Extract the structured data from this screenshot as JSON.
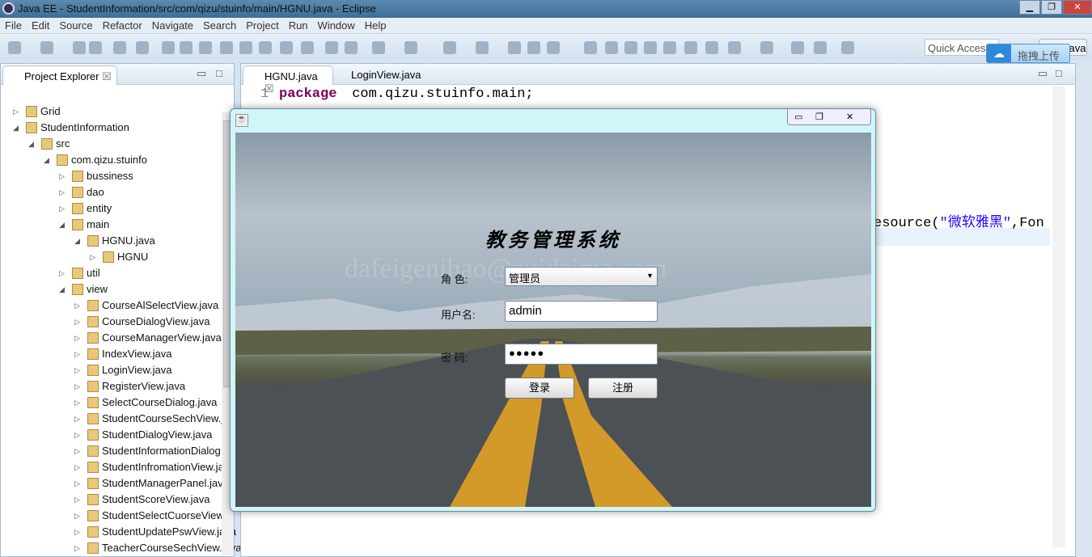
{
  "window": {
    "title": "Java EE - StudentInformation/src/com/qizu/stuinfo/main/HGNU.java - Eclipse",
    "minimize": "▁",
    "restore": "❐",
    "close": "✕"
  },
  "menu": [
    "File",
    "Edit",
    "Source",
    "Refactor",
    "Navigate",
    "Search",
    "Project",
    "Run",
    "Window",
    "Help"
  ],
  "quick_access": "Quick Access",
  "perspective": "Java EE",
  "upload": {
    "label": "拖拽上传"
  },
  "project_explorer": {
    "title": "Project Explorer",
    "items": [
      {
        "label": "Grid",
        "depth": 0,
        "open": false
      },
      {
        "label": "StudentInformation",
        "depth": 0,
        "open": true
      },
      {
        "label": "src",
        "depth": 1,
        "open": true
      },
      {
        "label": "com.qizu.stuinfo",
        "depth": 2,
        "open": true
      },
      {
        "label": "bussiness",
        "depth": 3,
        "open": false
      },
      {
        "label": "dao",
        "depth": 3,
        "open": false
      },
      {
        "label": "entity",
        "depth": 3,
        "open": false
      },
      {
        "label": "main",
        "depth": 3,
        "open": true
      },
      {
        "label": "HGNU.java",
        "depth": 4,
        "open": true
      },
      {
        "label": "HGNU",
        "depth": 5,
        "open": false
      },
      {
        "label": "util",
        "depth": 3,
        "open": false
      },
      {
        "label": "view",
        "depth": 3,
        "open": true
      },
      {
        "label": "CourseAlSelectView.java",
        "depth": 4,
        "open": false
      },
      {
        "label": "CourseDialogView.java",
        "depth": 4,
        "open": false
      },
      {
        "label": "CourseManagerView.java",
        "depth": 4,
        "open": false
      },
      {
        "label": "IndexView.java",
        "depth": 4,
        "open": false
      },
      {
        "label": "LoginView.java",
        "depth": 4,
        "open": false
      },
      {
        "label": "RegisterView.java",
        "depth": 4,
        "open": false
      },
      {
        "label": "SelectCourseDialog.java",
        "depth": 4,
        "open": false
      },
      {
        "label": "StudentCourseSechView.java",
        "depth": 4,
        "open": false
      },
      {
        "label": "StudentDialogView.java",
        "depth": 4,
        "open": false
      },
      {
        "label": "StudentInformationDialog",
        "depth": 4,
        "open": false
      },
      {
        "label": "StudentInfromationView.java",
        "depth": 4,
        "open": false
      },
      {
        "label": "StudentManagerPanel.java",
        "depth": 4,
        "open": false
      },
      {
        "label": "StudentScoreView.java",
        "depth": 4,
        "open": false
      },
      {
        "label": "StudentSelectCuorseView",
        "depth": 4,
        "open": false
      },
      {
        "label": "StudentUpdatePswView.java",
        "depth": 4,
        "open": false
      },
      {
        "label": "TeacherCourseSechView.java",
        "depth": 4,
        "open": false
      }
    ]
  },
  "editor": {
    "tabs": [
      "HGNU.java",
      "LoginView.java"
    ],
    "line1_no": "1",
    "line1_kw": "package",
    "line1_rest": " com.qizu.stuinfo.main;",
    "line_frag_a": "esource(",
    "line_frag_str": "\"微软雅黑\"",
    "line_frag_b": ",Fon"
  },
  "dialog": {
    "title": "教务管理系统",
    "watermark": "dafeigenihao@zuidaima.com",
    "role_label": "角  色:",
    "role_value": "管理员",
    "user_label": "用户名:",
    "user_value": "admin",
    "pwd_label": "密  码:",
    "pwd_value": "●●●●●",
    "login": "登录",
    "register": "注册"
  },
  "colors": {
    "keyword": "#7f0055",
    "string": "#2a00ff",
    "lane": "#d39a2a"
  }
}
